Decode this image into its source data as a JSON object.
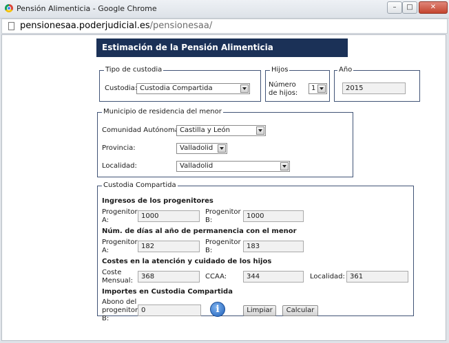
{
  "window": {
    "title": "Pensión Alimenticia - Google Chrome",
    "url_host": "pensionesaa.poderjudicial.es",
    "url_path": "/pensionesaa/",
    "minimize_label": "–",
    "maximize_label": "□",
    "close_label": "✕"
  },
  "form": {
    "header": "Estimación de la Pensión Alimenticia",
    "custody": {
      "legend": "Tipo de custodia",
      "label": "Custodia:",
      "value": "Custodia Compartida"
    },
    "children": {
      "legend": "Hijos",
      "label_line1": "Número",
      "label_line2": "de hijos:",
      "value": "1"
    },
    "year": {
      "legend": "Año",
      "value": "2015"
    },
    "municipality": {
      "legend": "Municipio de residencia del menor",
      "community_label": "Comunidad Autónoma:",
      "community_value": "Castilla y León",
      "province_label": "Provincia:",
      "province_value": "Valladolid",
      "locality_label": "Localidad:",
      "locality_value": "Valladolid"
    },
    "shared": {
      "legend": "Custodia Compartida",
      "income_heading": "Ingresos de los progenitores",
      "parent_a_line1": "Progenitor",
      "parent_a_line2": "A:",
      "parent_b_line1": "Progenitor",
      "parent_b_line2": "B:",
      "income_a": "1000",
      "income_b": "1000",
      "days_heading": "Núm. de días al año de permanencia con el menor",
      "days_a": "182",
      "days_b": "183",
      "costs_heading": "Costes en la atención y cuidado de los hijos",
      "monthly_cost_line1": "Coste",
      "monthly_cost_line2": "Mensual:",
      "monthly_cost": "368",
      "ccaa_label": "CCAA:",
      "ccaa_value": "344",
      "locality_label": "Localidad:",
      "locality_value": "361",
      "amounts_heading": "Importes en Custodia Compartida",
      "payment_line1": "Abono del",
      "payment_line2": "progenitor",
      "payment_line3": "B:",
      "payment_value": "0",
      "info_icon": "i",
      "clear_button": "Limpiar",
      "calculate_button": "Calcular"
    }
  },
  "colors": {
    "header_bg": "#1b3157",
    "fieldset_border": "#3f5275"
  }
}
